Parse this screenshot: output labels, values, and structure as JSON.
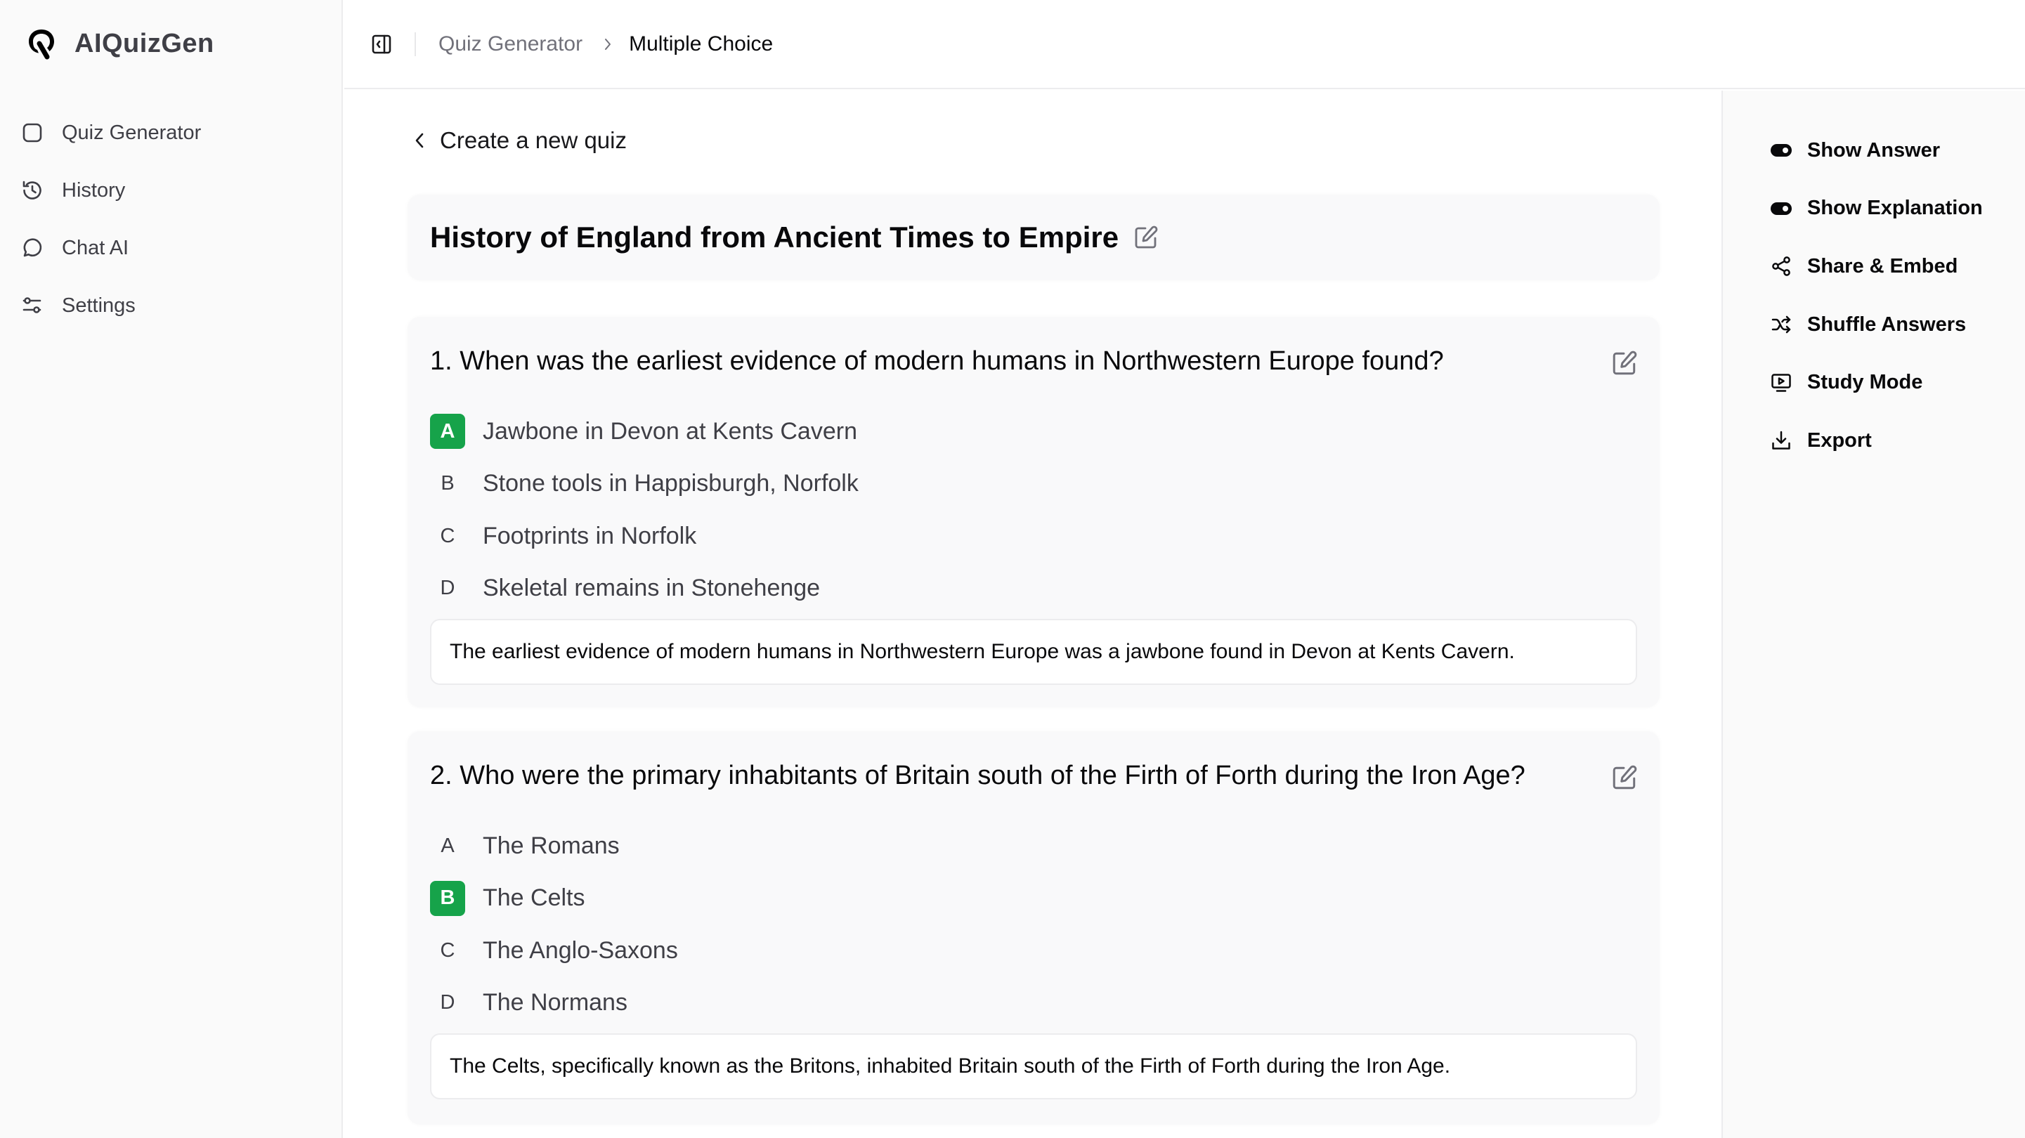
{
  "app": {
    "name": "AIQuizGen",
    "logo_icon": "q-logo-icon"
  },
  "sidebar": {
    "items": [
      {
        "label": "Quiz Generator",
        "icon": "square-icon"
      },
      {
        "label": "History",
        "icon": "history-icon"
      },
      {
        "label": "Chat AI",
        "icon": "chat-bubble-icon"
      },
      {
        "label": "Settings",
        "icon": "sliders-icon"
      }
    ]
  },
  "header": {
    "toggle_icon": "sidebar-toggle-icon",
    "breadcrumb": [
      {
        "label": "Quiz Generator"
      },
      {
        "label": "Multiple Choice"
      }
    ]
  },
  "main": {
    "back_label": "Create a new quiz",
    "quiz_title": "History of England from Ancient Times to Empire",
    "questions": [
      {
        "number": "1.",
        "text": "1. When was the earliest evidence of modern humans in Northwestern Europe found?",
        "options": [
          {
            "letter": "A",
            "text": "Jawbone in Devon at Kents Cavern",
            "correct": true
          },
          {
            "letter": "B",
            "text": "Stone tools in Happisburgh, Norfolk",
            "correct": false
          },
          {
            "letter": "C",
            "text": "Footprints in Norfolk",
            "correct": false
          },
          {
            "letter": "D",
            "text": "Skeletal remains in Stonehenge",
            "correct": false
          }
        ],
        "explanation": "The earliest evidence of modern humans in Northwestern Europe was a jawbone found in Devon at Kents Cavern."
      },
      {
        "number": "2.",
        "text": "2. Who were the primary inhabitants of Britain south of the Firth of Forth during the Iron Age?",
        "options": [
          {
            "letter": "A",
            "text": "The Romans",
            "correct": false
          },
          {
            "letter": "B",
            "text": "The Celts",
            "correct": true
          },
          {
            "letter": "C",
            "text": "The Anglo-Saxons",
            "correct": false
          },
          {
            "letter": "D",
            "text": "The Normans",
            "correct": false
          }
        ],
        "explanation": "The Celts, specifically known as the Britons, inhabited Britain south of the Firth of Forth during the Iron Age."
      }
    ]
  },
  "right_panel": {
    "actions": [
      {
        "label": "Show Answer",
        "icon": "toggle-on-icon",
        "state": "on"
      },
      {
        "label": "Show Explanation",
        "icon": "toggle-on-icon",
        "state": "on"
      },
      {
        "label": "Share & Embed",
        "icon": "share-icon"
      },
      {
        "label": "Shuffle Answers",
        "icon": "shuffle-icon"
      },
      {
        "label": "Study Mode",
        "icon": "monitor-play-icon"
      },
      {
        "label": "Export",
        "icon": "download-icon"
      }
    ]
  },
  "colors": {
    "correct_badge": "#16a34a",
    "sidebar_bg": "#fafafa",
    "card_bg": "#f9f9fa",
    "text_primary": "#09090b",
    "text_muted": "#71717a"
  }
}
